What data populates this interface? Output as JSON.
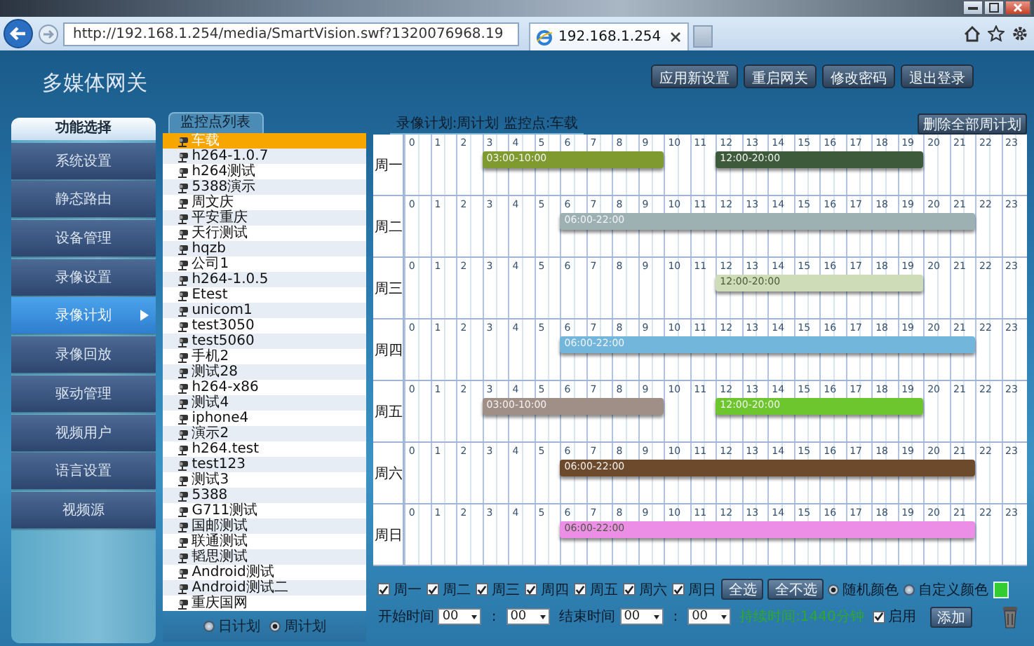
{
  "browser": {
    "url": "http://192.168.1.254/media/SmartVision.swf?1320076968.19",
    "tab": "192.168.1.254"
  },
  "header": {
    "title": "多媒体网关",
    "buttons": [
      "应用新设置",
      "重启网关",
      "修改密码",
      "退出登录"
    ]
  },
  "sidebar": {
    "title": "功能选择",
    "items": [
      {
        "label": "系统设置",
        "selected": false
      },
      {
        "label": "静态路由",
        "selected": false
      },
      {
        "label": "设备管理",
        "selected": false
      },
      {
        "label": "录像设置",
        "selected": false
      },
      {
        "label": "录像计划",
        "selected": true
      },
      {
        "label": "录像回放",
        "selected": false
      },
      {
        "label": "驱动管理",
        "selected": false
      },
      {
        "label": "视频用户",
        "selected": false
      },
      {
        "label": "语言设置",
        "selected": false
      },
      {
        "label": "视频源",
        "selected": false
      }
    ]
  },
  "camera_list": {
    "title": "监控点列表",
    "items": [
      {
        "label": "车载",
        "selected": true
      },
      {
        "label": "h264-1.0.7",
        "selected": false
      },
      {
        "label": "h264测试",
        "selected": false
      },
      {
        "label": "5388演示",
        "selected": false
      },
      {
        "label": "周文庆",
        "selected": false
      },
      {
        "label": "平安重庆",
        "selected": false
      },
      {
        "label": "天行测试",
        "selected": false
      },
      {
        "label": "hqzb",
        "selected": false
      },
      {
        "label": "公司1",
        "selected": false
      },
      {
        "label": "h264-1.0.5",
        "selected": false
      },
      {
        "label": "Etest",
        "selected": false
      },
      {
        "label": "unicom1",
        "selected": false
      },
      {
        "label": "test3050",
        "selected": false
      },
      {
        "label": "test5060",
        "selected": false
      },
      {
        "label": "手机2",
        "selected": false
      },
      {
        "label": "测试28",
        "selected": false
      },
      {
        "label": "h264-x86",
        "selected": false
      },
      {
        "label": "测试4",
        "selected": false
      },
      {
        "label": "iphone4",
        "selected": false
      },
      {
        "label": "演示2",
        "selected": false
      },
      {
        "label": "h264.test",
        "selected": false
      },
      {
        "label": "test123",
        "selected": false
      },
      {
        "label": "测试3",
        "selected": false
      },
      {
        "label": "5388",
        "selected": false
      },
      {
        "label": "G711测试",
        "selected": false
      },
      {
        "label": "国邮测试",
        "selected": false
      },
      {
        "label": "联通测试",
        "selected": false
      },
      {
        "label": "韬思测试",
        "selected": false
      },
      {
        "label": "Android测试",
        "selected": false
      },
      {
        "label": "Android测试二",
        "selected": false
      },
      {
        "label": "重庆国网",
        "selected": false
      }
    ],
    "plan_types": [
      {
        "label": "日计划",
        "selected": false
      },
      {
        "label": "周计划",
        "selected": true
      }
    ]
  },
  "schedule": {
    "title": "录像计划:周计划 监控点:车载",
    "delete_button": "删除全部周计划",
    "days": [
      {
        "label": "周一",
        "hours": [
          "0",
          "1",
          "2",
          "3",
          "4",
          "5",
          "6",
          "7",
          "8",
          "9",
          "10",
          "11",
          "12",
          "13",
          "14",
          "15",
          "16",
          "17",
          "18",
          "19",
          "20",
          "21",
          "22",
          "23"
        ],
        "slots": [
          {
            "label": "03:00-10:00",
            "color": "#7f9a2e"
          },
          {
            "label": "12:00-20:00",
            "color": "#3d5a3b"
          }
        ]
      },
      {
        "label": "周二",
        "hours": [
          "0",
          "1",
          "2",
          "3",
          "4",
          "5",
          "6",
          "7",
          "8",
          "9",
          "10",
          "11",
          "12",
          "13",
          "14",
          "15",
          "16",
          "17",
          "18",
          "19",
          "20",
          "21",
          "22",
          "23"
        ],
        "slots": [
          {
            "label": "06:00-22:00",
            "color": "#9db1b3"
          }
        ]
      },
      {
        "label": "周三",
        "hours": [
          "0",
          "1",
          "2",
          "3",
          "4",
          "5",
          "6",
          "7",
          "8",
          "9",
          "10",
          "11",
          "12",
          "13",
          "14",
          "15",
          "16",
          "17",
          "18",
          "19",
          "20",
          "21",
          "22",
          "23"
        ],
        "slots": [
          {
            "label": "12:00-20:00",
            "color": "#cfdcb8"
          }
        ]
      },
      {
        "label": "周四",
        "hours": [
          "0",
          "1",
          "2",
          "3",
          "4",
          "5",
          "6",
          "7",
          "8",
          "9",
          "10",
          "11",
          "12",
          "13",
          "14",
          "15",
          "16",
          "17",
          "18",
          "19",
          "20",
          "21",
          "22",
          "23"
        ],
        "slots": [
          {
            "label": "06:00-22:00",
            "color": "#73b6dc"
          }
        ]
      },
      {
        "label": "周五",
        "hours": [
          "0",
          "1",
          "2",
          "3",
          "4",
          "5",
          "6",
          "7",
          "8",
          "9",
          "10",
          "11",
          "12",
          "13",
          "14",
          "15",
          "16",
          "17",
          "18",
          "19",
          "20",
          "21",
          "22",
          "23"
        ],
        "slots": [
          {
            "label": "03:00-10:00",
            "color": "#a08f86"
          },
          {
            "label": "12:00-20:00",
            "color": "#6ec62e"
          }
        ]
      },
      {
        "label": "周六",
        "hours": [
          "0",
          "1",
          "2",
          "3",
          "4",
          "5",
          "6",
          "7",
          "8",
          "9",
          "10",
          "11",
          "12",
          "13",
          "14",
          "15",
          "16",
          "17",
          "18",
          "19",
          "20",
          "21",
          "22",
          "23"
        ],
        "slots": [
          {
            "label": "06:00-22:00",
            "color": "#6c4a2b"
          }
        ]
      },
      {
        "label": "周日",
        "hours": [
          "0",
          "1",
          "2",
          "3",
          "4",
          "5",
          "6",
          "7",
          "8",
          "9",
          "10",
          "11",
          "12",
          "13",
          "14",
          "15",
          "16",
          "17",
          "18",
          "19",
          "20",
          "21",
          "22",
          "23"
        ],
        "slots": [
          {
            "label": "06:00-22:00",
            "color": "#ec8ee6"
          }
        ]
      }
    ]
  },
  "controls": {
    "days": [
      {
        "label": "周一",
        "checked": true
      },
      {
        "label": "周二",
        "checked": true
      },
      {
        "label": "周三",
        "checked": true
      },
      {
        "label": "周四",
        "checked": true
      },
      {
        "label": "周五",
        "checked": true
      },
      {
        "label": "周六",
        "checked": true
      },
      {
        "label": "周日",
        "checked": true
      }
    ],
    "select_all": "全选",
    "select_none": "全不选",
    "color_modes": [
      {
        "label": "随机颜色",
        "selected": true
      },
      {
        "label": "自定义颜色",
        "selected": false
      }
    ],
    "start_label": "开始时间",
    "start_hour": "00",
    "start_separator": ":",
    "start_minute": "00",
    "end_label": "结束时间",
    "end_hour": "00",
    "end_separator": ":",
    "end_minute": "00",
    "duration": "持续时间:1440分钟",
    "enable": {
      "label": "启用",
      "checked": true
    },
    "add_button": "添加"
  }
}
